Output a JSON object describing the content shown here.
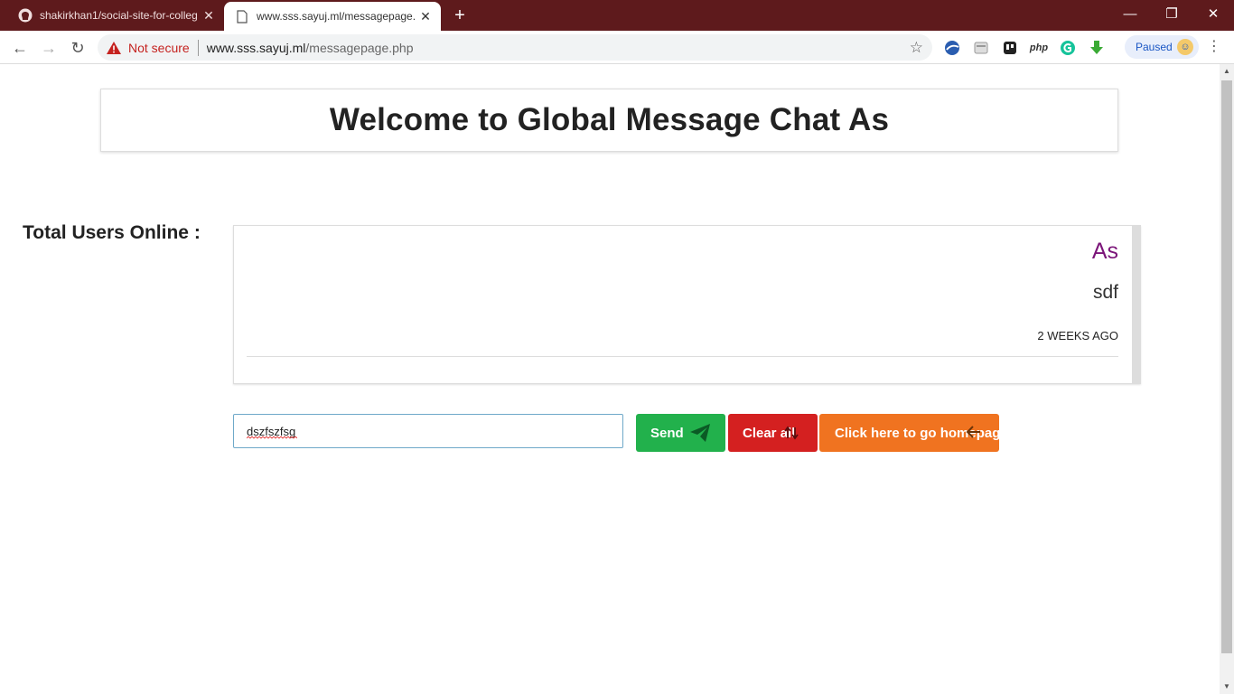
{
  "browser": {
    "tabs": [
      {
        "title": "shakirkhan1/social-site-for-colleg",
        "active": false
      },
      {
        "title": "www.sss.sayuj.ml/messagepage.p",
        "active": true
      }
    ],
    "security_label": "Not secure",
    "url_host": "www.sss.sayuj.ml",
    "url_path": "/messagepage.php",
    "php_ext_label": "php",
    "profile_label": "Paused"
  },
  "page": {
    "heading": "Welcome to Global Message Chat As",
    "online_label": "Total Users Online :",
    "messages": [
      {
        "user": "As",
        "text": "sdf",
        "time": "2 weeks ago"
      }
    ],
    "input_value": "dszfszfsg",
    "buttons": {
      "send": "Send",
      "clear": "Clear all",
      "home": "Click here to go homepage"
    }
  },
  "colors": {
    "titlebar": "#5e1a1c",
    "send": "#22b14c",
    "clear": "#d42020",
    "home": "#f07320",
    "username": "#7b1579"
  }
}
